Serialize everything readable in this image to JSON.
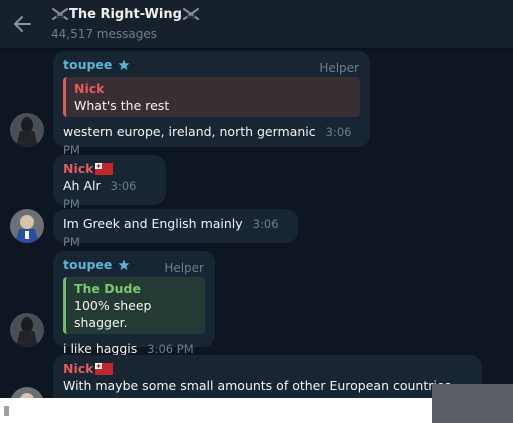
{
  "header": {
    "title": "The Right-Wing",
    "subtitle": "44,517 messages"
  },
  "messages": [
    {
      "sender": "toupee",
      "role": "Helper",
      "reply_to": {
        "name": "Nick",
        "text": "What's the rest"
      },
      "text": "western europe, ireland, north germanic",
      "time": "3:06 PM"
    },
    {
      "sender": "Nick",
      "text": "Ah Alr",
      "time": "3:06 PM"
    },
    {
      "text": "Im Greek and English mainly",
      "time": "3:06 PM"
    },
    {
      "sender": "toupee",
      "role": "Helper",
      "reply_to": {
        "name": "The Dude",
        "text": "100% sheep shagger."
      },
      "text": "i like haggis",
      "time": "3:06 PM"
    },
    {
      "sender": "Nick",
      "text": "With maybe some small amounts of other European countries"
    }
  ],
  "colors": {
    "background": "#0e1621",
    "bubble": "#182533",
    "name_blue": "#5cb5d9",
    "name_red": "#e35c5c",
    "reply_green": "#6fbf6a"
  }
}
